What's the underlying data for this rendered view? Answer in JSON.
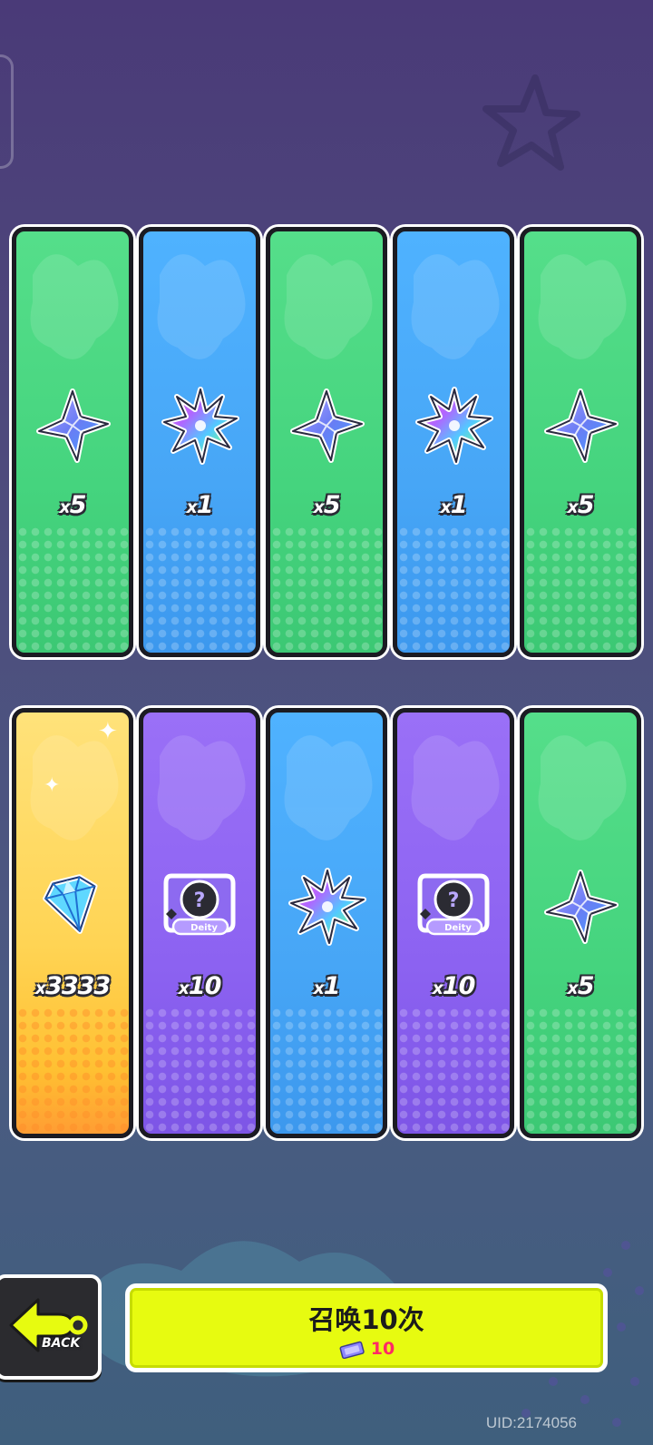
{
  "rewards": [
    {
      "color": "green",
      "icon": "crystal-icon",
      "prefix": "x",
      "amount": "5"
    },
    {
      "color": "blue",
      "icon": "rainbow-shard-icon",
      "prefix": "x",
      "amount": "1"
    },
    {
      "color": "green",
      "icon": "crystal-icon",
      "prefix": "x",
      "amount": "5"
    },
    {
      "color": "blue",
      "icon": "rainbow-shard-icon",
      "prefix": "x",
      "amount": "1"
    },
    {
      "color": "green",
      "icon": "crystal-icon",
      "prefix": "x",
      "amount": "5"
    },
    {
      "color": "gold",
      "icon": "diamond-icon",
      "prefix": "x",
      "amount": "3333"
    },
    {
      "color": "purple",
      "icon": "deity-card-icon",
      "prefix": "x",
      "amount": "10"
    },
    {
      "color": "blue",
      "icon": "rainbow-shard-icon",
      "prefix": "x",
      "amount": "1"
    },
    {
      "color": "purple",
      "icon": "deity-card-icon",
      "prefix": "x",
      "amount": "10"
    },
    {
      "color": "green",
      "icon": "crystal-icon",
      "prefix": "x",
      "amount": "5"
    }
  ],
  "deity_card_label": "Deity",
  "back_button": {
    "label": "BACK"
  },
  "summon_button": {
    "label": "召唤10次",
    "cost": "10",
    "cost_icon": "ticket-icon"
  },
  "uid": "UID:2174056",
  "colors": {
    "green": "#4cd985",
    "blue": "#47a6f6",
    "purple": "#8c62f1",
    "gold": "#ffd454",
    "summon": "#e7fb10",
    "cost": "#ff2a66"
  }
}
